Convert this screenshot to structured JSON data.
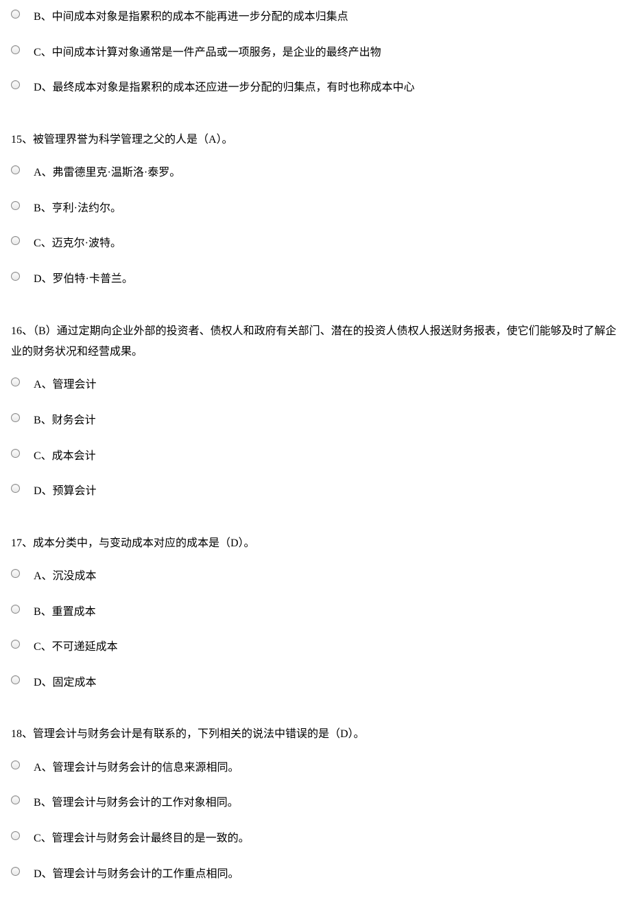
{
  "questions": [
    {
      "stem": "",
      "options": [
        "B、中间成本对象是指累积的成本不能再进一步分配的成本归集点",
        "C、中间成本计算对象通常是一件产品或一项服务，是企业的最终产出物",
        "D、最终成本对象是指累积的成本还应进一步分配的归集点，有时也称成本中心"
      ]
    },
    {
      "stem": "15、被管理界誉为科学管理之父的人是（A）。",
      "options": [
        "A、弗雷德里克·温斯洛·泰罗。",
        "B、亨利·法约尔。",
        "C、迈克尔·波特。",
        "D、罗伯特·卡普兰。"
      ]
    },
    {
      "stem": "16、（B）通过定期向企业外部的投资者、债权人和政府有关部门、潜在的投资人债权人报送财务报表，使它们能够及时了解企业的财务状况和经营成果。",
      "options": [
        "A、管理会计",
        "B、财务会计",
        "C、成本会计",
        "D、预算会计"
      ]
    },
    {
      "stem": "17、成本分类中，与变动成本对应的成本是（D）。",
      "options": [
        "A、沉没成本",
        "B、重置成本",
        "C、不可递延成本",
        "D、固定成本"
      ]
    },
    {
      "stem": "18、管理会计与财务会计是有联系的，下列相关的说法中错误的是（D）。",
      "options": [
        "A、管理会计与财务会计的信息来源相同。",
        "B、管理会计与财务会计的工作对象相同。",
        "C、管理会计与财务会计最终目的是一致的。",
        "D、管理会计与财务会计的工作重点相同。"
      ]
    }
  ]
}
